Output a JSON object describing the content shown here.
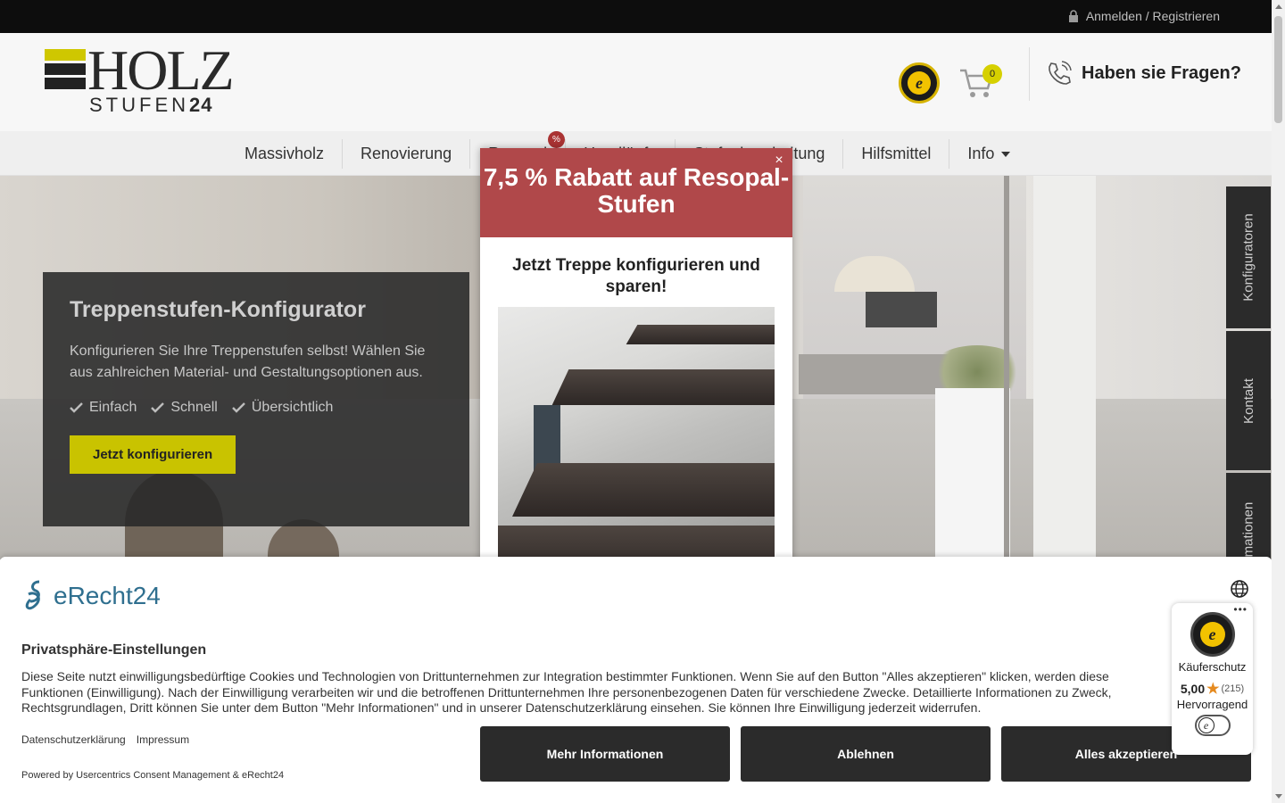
{
  "topbar": {
    "account_link": "Anmelden / Registrieren"
  },
  "header": {
    "logo_word": "HOLZ",
    "logo_sub": "STUFEN",
    "logo_num": "24",
    "cart_count": "0",
    "help_text": "Haben sie Fragen?"
  },
  "nav": {
    "items": [
      {
        "label": "Massivholz"
      },
      {
        "label": "Renovierung"
      },
      {
        "label": "Resopal"
      },
      {
        "label": "Handläufe"
      },
      {
        "label": "Stufenbearbeitung"
      },
      {
        "label": "Hilfsmittel"
      },
      {
        "label": "Info"
      }
    ],
    "sale_badge": "%"
  },
  "hero": {
    "title": "Treppenstufen-Konfigurator",
    "description": "Konfigurieren Sie Ihre Treppenstufen selbst! Wählen Sie aus zahlreichen Material- und Gestaltungsoptionen aus.",
    "checks": [
      "Einfach",
      "Schnell",
      "Übersichtlich"
    ],
    "cta": "Jetzt konfigurieren"
  },
  "side_tabs": [
    {
      "label": "Konfiguratoren"
    },
    {
      "label": "Kontakt"
    },
    {
      "label": "Informationen"
    }
  ],
  "popup": {
    "title": "7,5 % Rabatt auf Resopal-Stufen",
    "subtitle": "Jetzt Treppe konfigurieren und sparen!",
    "close": "×"
  },
  "consent": {
    "brand": "eRecht24",
    "heading": "Privatsphäre-Einstellungen",
    "text": "Diese Seite nutzt einwilligungsbedürftige Cookies und Technologien von Drittunternehmen zur Integration bestimmter Funktionen. Wenn Sie auf den Button \"Alles akzeptieren\" klicken, werden diese Funktionen (Einwilligung). Nach der Einwilligung verarbeiten wir und die betroffenen Drittunternehmen Ihre personenbezogenen Daten für verschiedene Zwecke. Detaillierte Informationen zu Zweck, Rechtsgrundlagen, Dritt können Sie unter dem Button \"Mehr Informationen\" und in unserer Datenschutzerklärung einsehen. Sie können Ihre Einwilligung jederzeit widerrufen.",
    "privacy_link": "Datenschutzerklärung",
    "imprint_link": "Impressum",
    "powered_by": "Powered by Usercentrics Consent Management & eRecht24",
    "btn_more": "Mehr Informationen",
    "btn_decline": "Ablehnen",
    "btn_accept": "Alles akzeptieren"
  },
  "trusted_widget": {
    "label": "Käuferschutz",
    "score": "5,00",
    "count": "(215)",
    "verdict": "Hervorragend",
    "star_color": "#e58a1f"
  },
  "colors": {
    "accent_yellow": "#c9c300",
    "popup_red": "#b0484a",
    "dark_button": "#2b2b2b"
  }
}
